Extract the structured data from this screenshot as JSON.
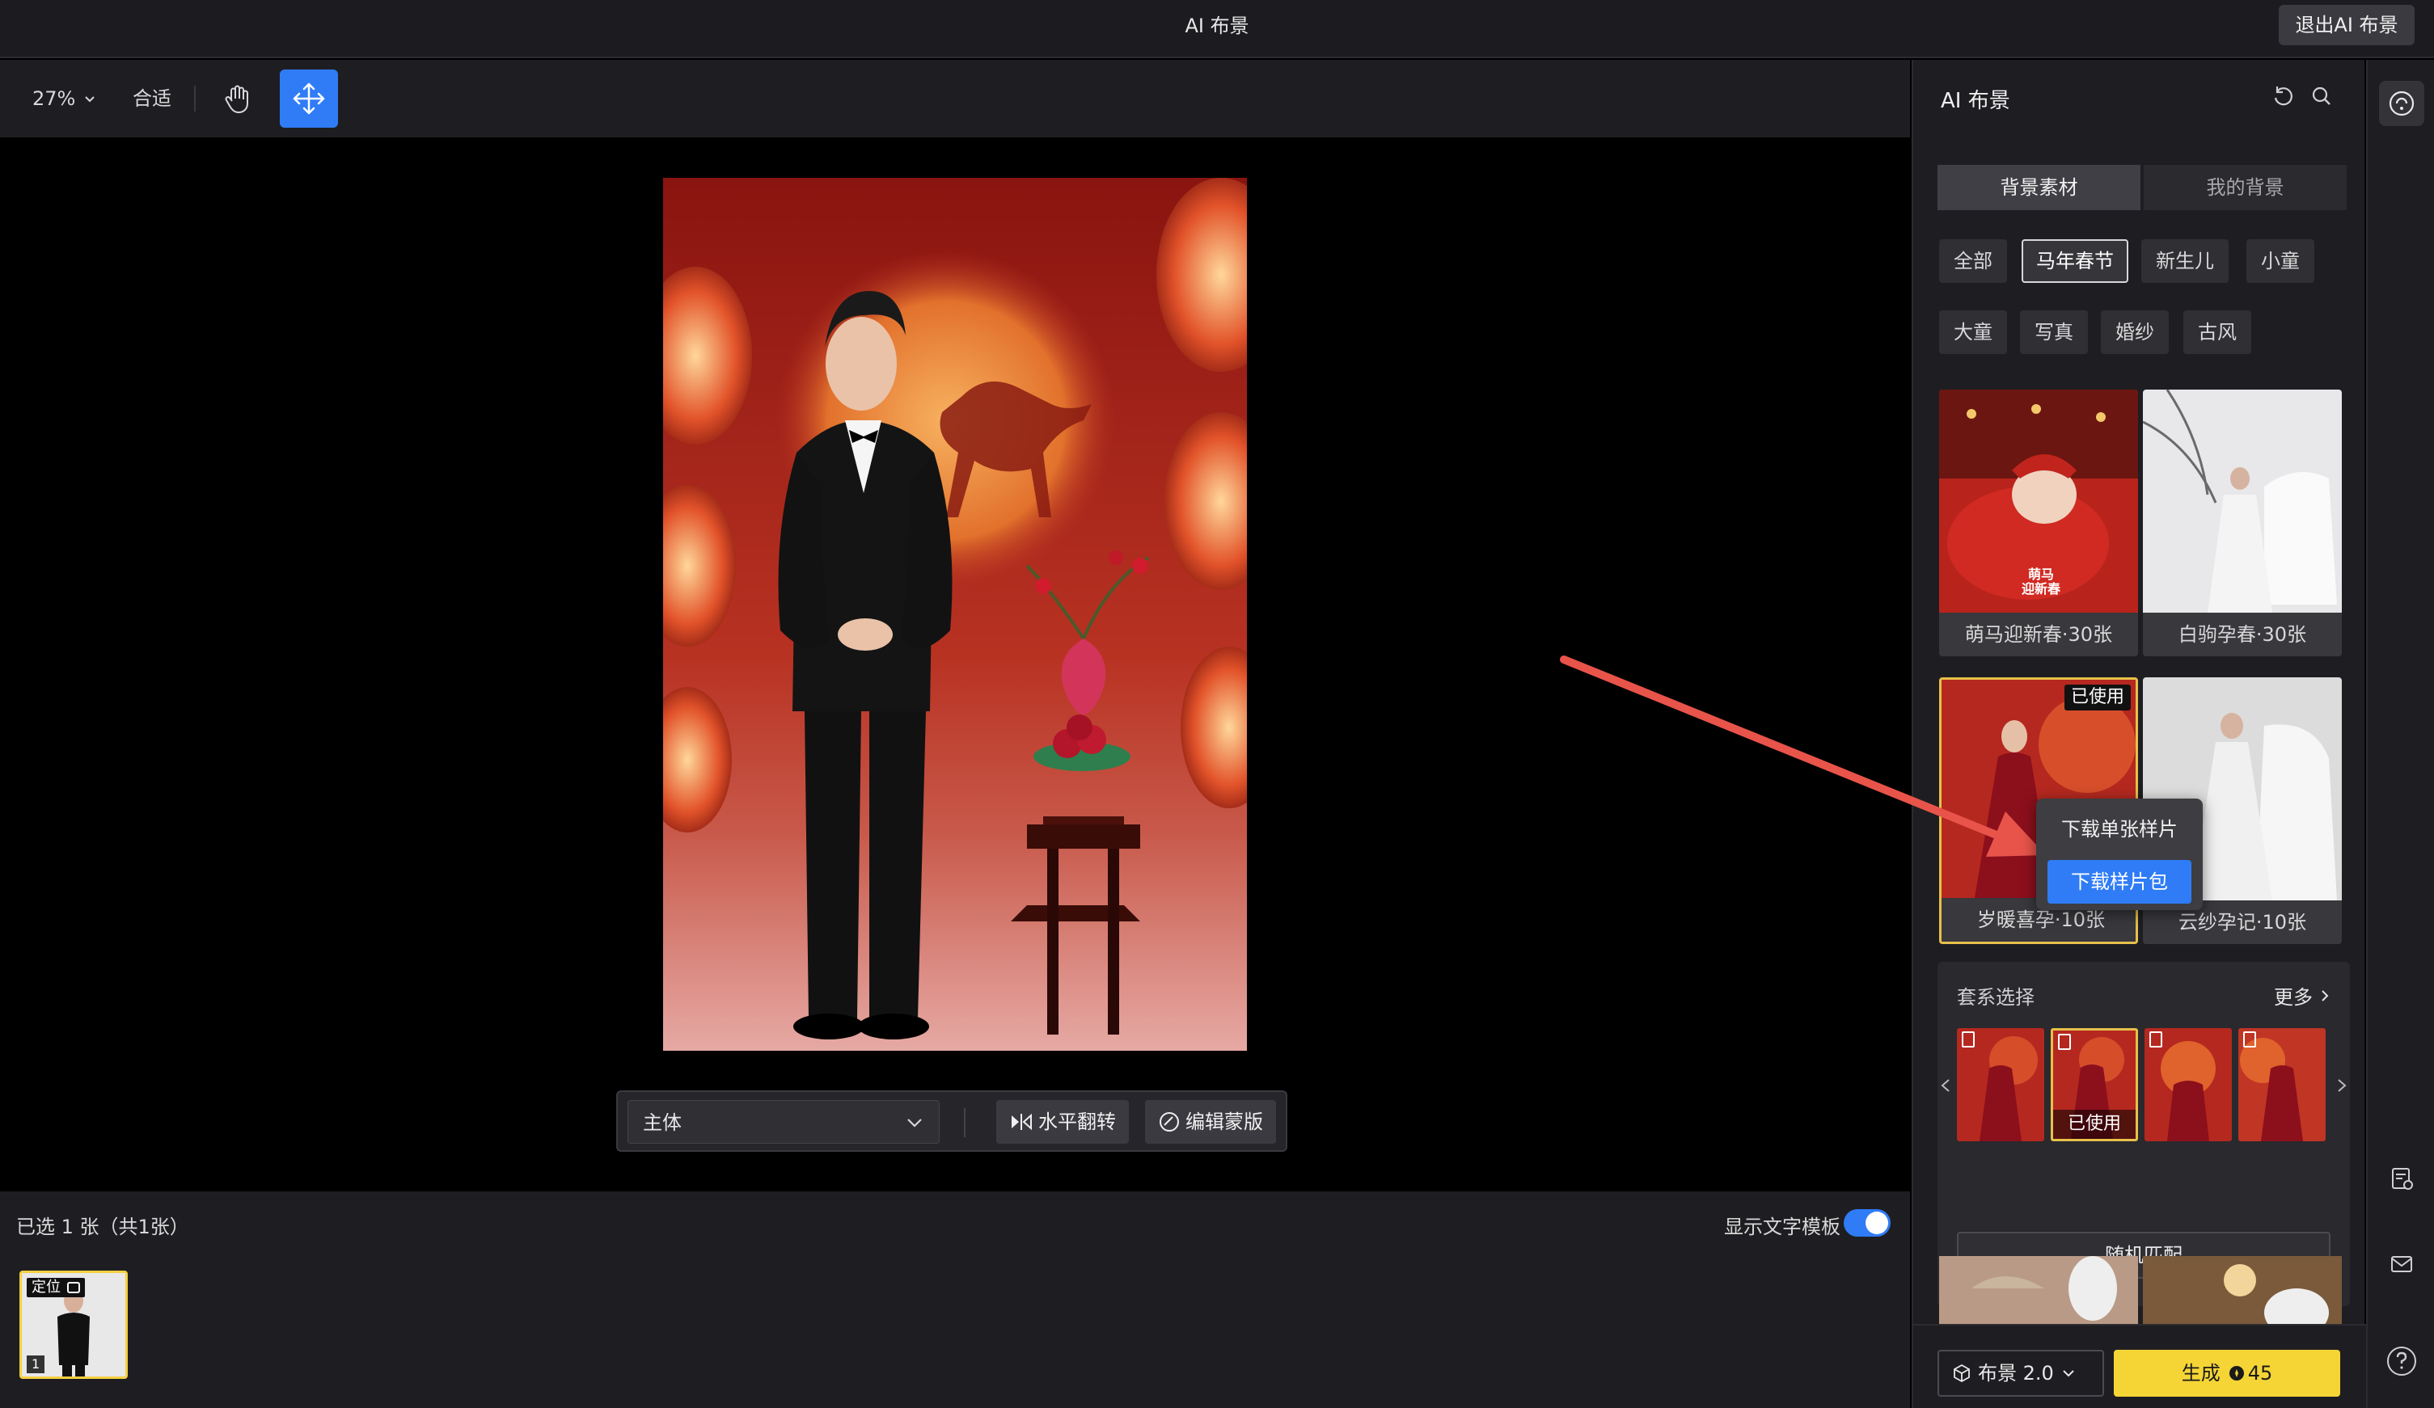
{
  "window": {
    "title": "AI 布景",
    "exit_label": "退出AI 布景"
  },
  "toolbar": {
    "zoom": "27%",
    "fit": "合适"
  },
  "object_bar": {
    "subject": "主体",
    "flip": "水平翻转",
    "edit_mask": "编辑蒙版"
  },
  "filmstrip": {
    "selected_count": "已选 1 张（共1张）",
    "show_text_template": "显示文字模板",
    "toggle_on": true,
    "thumb_tag": "定位",
    "thumb_index": "1"
  },
  "panel": {
    "title": "AI 布景",
    "tabs": [
      {
        "label": "背景素材",
        "active": true
      },
      {
        "label": "我的背景",
        "active": false
      }
    ],
    "categories": [
      {
        "label": "全部"
      },
      {
        "label": "马年春节"
      },
      {
        "label": "新生儿"
      },
      {
        "label": "小童"
      },
      {
        "label": "大童"
      },
      {
        "label": "写真"
      },
      {
        "label": "婚纱"
      },
      {
        "label": "古风"
      }
    ],
    "active_category": "马年春节",
    "cards": [
      {
        "caption": "萌马迎新春·30张",
        "art_text": "萌马\n迎新春"
      },
      {
        "caption": "白驹孕春·30张"
      },
      {
        "caption": "岁暖喜孕·10张",
        "badge": "已使用"
      },
      {
        "caption": "云纱孕记·10张"
      }
    ],
    "download_menu": {
      "single": "下载单张样片",
      "pack": "下载样片包"
    },
    "series": {
      "title": "套系选择",
      "more": "更多",
      "used": "已使用",
      "random": "随机匹配"
    },
    "model": "布景 2.0",
    "generate": {
      "label": "生成",
      "cost": "45"
    }
  },
  "colors": {
    "accent": "#2f7cf6",
    "generate": "#f5d536",
    "selected_border": "#e7c04a",
    "arrow": "#e8544a"
  }
}
